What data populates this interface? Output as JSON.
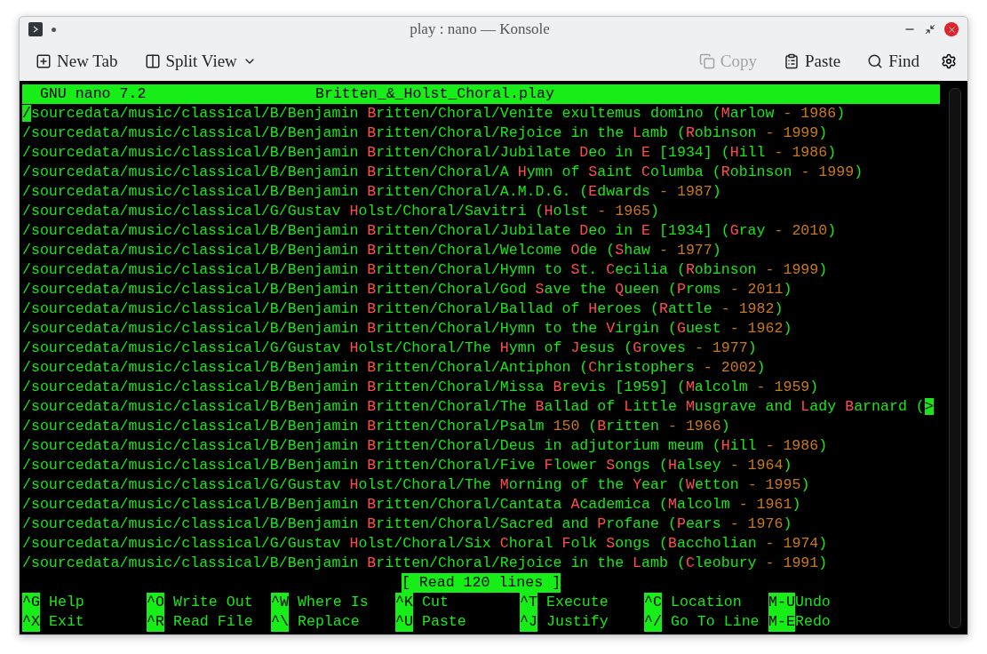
{
  "window": {
    "title": "play : nano — Konsole"
  },
  "toolbar": {
    "left": [
      {
        "label": "New Tab",
        "kind": "new-tab",
        "disabled": false
      },
      {
        "label": "Split View",
        "kind": "split",
        "disabled": false
      }
    ],
    "right": [
      {
        "label": "Copy",
        "kind": "copy",
        "disabled": true
      },
      {
        "label": "Paste",
        "kind": "paste",
        "disabled": false
      },
      {
        "label": "Find",
        "kind": "find",
        "disabled": false
      }
    ]
  },
  "editor": {
    "version": "GNU nano 7.2",
    "filename": "Britten_&_Holst_Choral.play",
    "lines": [
      [
        {
          "text": "/",
          "kind": "cursor"
        },
        {
          "text": "sourcedata/music/classical/B/Benjamin ",
          "kind": "plain"
        },
        {
          "text": "B",
          "kind": "name"
        },
        {
          "text": "ritten/Choral/Venite exultemus domino (",
          "kind": "plain"
        },
        {
          "text": "M",
          "kind": "name"
        },
        {
          "text": "arlow ",
          "kind": "plain"
        },
        {
          "text": "- 1986",
          "kind": "number"
        },
        {
          "text": ")",
          "kind": "plain"
        }
      ],
      [
        {
          "text": "/sourcedata/music/classical/B/Benjamin ",
          "kind": "plain"
        },
        {
          "text": "B",
          "kind": "name"
        },
        {
          "text": "ritten/Choral/Rejoice in the ",
          "kind": "plain"
        },
        {
          "text": "L",
          "kind": "name"
        },
        {
          "text": "amb (",
          "kind": "plain"
        },
        {
          "text": "R",
          "kind": "name"
        },
        {
          "text": "obinson ",
          "kind": "plain"
        },
        {
          "text": "- 1999",
          "kind": "number"
        },
        {
          "text": ")",
          "kind": "plain"
        }
      ],
      [
        {
          "text": "/sourcedata/music/classical/B/Benjamin ",
          "kind": "plain"
        },
        {
          "text": "B",
          "kind": "name"
        },
        {
          "text": "ritten/Choral/Jubilate ",
          "kind": "plain"
        },
        {
          "text": "D",
          "kind": "name"
        },
        {
          "text": "eo in ",
          "kind": "plain"
        },
        {
          "text": "E",
          "kind": "name"
        },
        {
          "text": " [1934] (",
          "kind": "plain"
        },
        {
          "text": "H",
          "kind": "name"
        },
        {
          "text": "ill ",
          "kind": "plain"
        },
        {
          "text": "- 1986",
          "kind": "number"
        },
        {
          "text": ")",
          "kind": "plain"
        }
      ],
      [
        {
          "text": "/sourcedata/music/classical/B/Benjamin ",
          "kind": "plain"
        },
        {
          "text": "B",
          "kind": "name"
        },
        {
          "text": "ritten/Choral/A ",
          "kind": "plain"
        },
        {
          "text": "H",
          "kind": "name"
        },
        {
          "text": "ymn of ",
          "kind": "plain"
        },
        {
          "text": "S",
          "kind": "name"
        },
        {
          "text": "aint ",
          "kind": "plain"
        },
        {
          "text": "C",
          "kind": "name"
        },
        {
          "text": "olumba (",
          "kind": "plain"
        },
        {
          "text": "R",
          "kind": "name"
        },
        {
          "text": "obinson ",
          "kind": "plain"
        },
        {
          "text": "- 1999",
          "kind": "number"
        },
        {
          "text": ")",
          "kind": "plain"
        }
      ],
      [
        {
          "text": "/sourcedata/music/classical/B/Benjamin ",
          "kind": "plain"
        },
        {
          "text": "B",
          "kind": "name"
        },
        {
          "text": "ritten/Choral/A.M.D.G. (",
          "kind": "plain"
        },
        {
          "text": "E",
          "kind": "name"
        },
        {
          "text": "dwards ",
          "kind": "plain"
        },
        {
          "text": "- 1987",
          "kind": "number"
        },
        {
          "text": ")",
          "kind": "plain"
        }
      ],
      [
        {
          "text": "/sourcedata/music/classical/G/Gustav ",
          "kind": "plain"
        },
        {
          "text": "H",
          "kind": "name"
        },
        {
          "text": "olst/Choral/Savitri (",
          "kind": "plain"
        },
        {
          "text": "H",
          "kind": "name"
        },
        {
          "text": "olst ",
          "kind": "plain"
        },
        {
          "text": "- 1965",
          "kind": "number"
        },
        {
          "text": ")",
          "kind": "plain"
        }
      ],
      [
        {
          "text": "/sourcedata/music/classical/B/Benjamin ",
          "kind": "plain"
        },
        {
          "text": "B",
          "kind": "name"
        },
        {
          "text": "ritten/Choral/Jubilate ",
          "kind": "plain"
        },
        {
          "text": "D",
          "kind": "name"
        },
        {
          "text": "eo in ",
          "kind": "plain"
        },
        {
          "text": "E",
          "kind": "name"
        },
        {
          "text": " [1934] (",
          "kind": "plain"
        },
        {
          "text": "G",
          "kind": "name"
        },
        {
          "text": "ray ",
          "kind": "plain"
        },
        {
          "text": "- 2010",
          "kind": "number"
        },
        {
          "text": ")",
          "kind": "plain"
        }
      ],
      [
        {
          "text": "/sourcedata/music/classical/B/Benjamin ",
          "kind": "plain"
        },
        {
          "text": "B",
          "kind": "name"
        },
        {
          "text": "ritten/Choral/Welcome ",
          "kind": "plain"
        },
        {
          "text": "O",
          "kind": "name"
        },
        {
          "text": "de (",
          "kind": "plain"
        },
        {
          "text": "S",
          "kind": "name"
        },
        {
          "text": "haw ",
          "kind": "plain"
        },
        {
          "text": "- 1977",
          "kind": "number"
        },
        {
          "text": ")",
          "kind": "plain"
        }
      ],
      [
        {
          "text": "/sourcedata/music/classical/B/Benjamin ",
          "kind": "plain"
        },
        {
          "text": "B",
          "kind": "name"
        },
        {
          "text": "ritten/Choral/Hymn to ",
          "kind": "plain"
        },
        {
          "text": "S",
          "kind": "name"
        },
        {
          "text": "t. ",
          "kind": "plain"
        },
        {
          "text": "C",
          "kind": "name"
        },
        {
          "text": "ecilia (",
          "kind": "plain"
        },
        {
          "text": "R",
          "kind": "name"
        },
        {
          "text": "obinson ",
          "kind": "plain"
        },
        {
          "text": "- 1999",
          "kind": "number"
        },
        {
          "text": ")",
          "kind": "plain"
        }
      ],
      [
        {
          "text": "/sourcedata/music/classical/B/Benjamin ",
          "kind": "plain"
        },
        {
          "text": "B",
          "kind": "name"
        },
        {
          "text": "ritten/Choral/God ",
          "kind": "plain"
        },
        {
          "text": "S",
          "kind": "name"
        },
        {
          "text": "ave the ",
          "kind": "plain"
        },
        {
          "text": "Q",
          "kind": "name"
        },
        {
          "text": "ueen (",
          "kind": "plain"
        },
        {
          "text": "P",
          "kind": "name"
        },
        {
          "text": "roms ",
          "kind": "plain"
        },
        {
          "text": "- 2011",
          "kind": "number"
        },
        {
          "text": ")",
          "kind": "plain"
        }
      ],
      [
        {
          "text": "/sourcedata/music/classical/B/Benjamin ",
          "kind": "plain"
        },
        {
          "text": "B",
          "kind": "name"
        },
        {
          "text": "ritten/Choral/Ballad of ",
          "kind": "plain"
        },
        {
          "text": "H",
          "kind": "name"
        },
        {
          "text": "eroes (",
          "kind": "plain"
        },
        {
          "text": "R",
          "kind": "name"
        },
        {
          "text": "attle ",
          "kind": "plain"
        },
        {
          "text": "- 1982",
          "kind": "number"
        },
        {
          "text": ")",
          "kind": "plain"
        }
      ],
      [
        {
          "text": "/sourcedata/music/classical/B/Benjamin ",
          "kind": "plain"
        },
        {
          "text": "B",
          "kind": "name"
        },
        {
          "text": "ritten/Choral/Hymn to the ",
          "kind": "plain"
        },
        {
          "text": "V",
          "kind": "name"
        },
        {
          "text": "irgin (",
          "kind": "plain"
        },
        {
          "text": "G",
          "kind": "name"
        },
        {
          "text": "uest ",
          "kind": "plain"
        },
        {
          "text": "- 1962",
          "kind": "number"
        },
        {
          "text": ")",
          "kind": "plain"
        }
      ],
      [
        {
          "text": "/sourcedata/music/classical/G/Gustav ",
          "kind": "plain"
        },
        {
          "text": "H",
          "kind": "name"
        },
        {
          "text": "olst/Choral/The ",
          "kind": "plain"
        },
        {
          "text": "H",
          "kind": "name"
        },
        {
          "text": "ymn of ",
          "kind": "plain"
        },
        {
          "text": "J",
          "kind": "name"
        },
        {
          "text": "esus (",
          "kind": "plain"
        },
        {
          "text": "G",
          "kind": "name"
        },
        {
          "text": "roves ",
          "kind": "plain"
        },
        {
          "text": "- 1977",
          "kind": "number"
        },
        {
          "text": ")",
          "kind": "plain"
        }
      ],
      [
        {
          "text": "/sourcedata/music/classical/B/Benjamin ",
          "kind": "plain"
        },
        {
          "text": "B",
          "kind": "name"
        },
        {
          "text": "ritten/Choral/Antiphon (",
          "kind": "plain"
        },
        {
          "text": "C",
          "kind": "name"
        },
        {
          "text": "hristophers ",
          "kind": "plain"
        },
        {
          "text": "- 2002",
          "kind": "number"
        },
        {
          "text": ")",
          "kind": "plain"
        }
      ],
      [
        {
          "text": "/sourcedata/music/classical/B/Benjamin ",
          "kind": "plain"
        },
        {
          "text": "B",
          "kind": "name"
        },
        {
          "text": "ritten/Choral/Missa ",
          "kind": "plain"
        },
        {
          "text": "B",
          "kind": "name"
        },
        {
          "text": "revis [1959] (",
          "kind": "plain"
        },
        {
          "text": "M",
          "kind": "name"
        },
        {
          "text": "alcolm ",
          "kind": "plain"
        },
        {
          "text": "- 1959",
          "kind": "number"
        },
        {
          "text": ")",
          "kind": "plain"
        }
      ],
      [
        {
          "text": "/sourcedata/music/classical/B/Benjamin ",
          "kind": "plain"
        },
        {
          "text": "B",
          "kind": "name"
        },
        {
          "text": "ritten/Choral/The ",
          "kind": "plain"
        },
        {
          "text": "B",
          "kind": "name"
        },
        {
          "text": "allad of ",
          "kind": "plain"
        },
        {
          "text": "L",
          "kind": "name"
        },
        {
          "text": "ittle ",
          "kind": "plain"
        },
        {
          "text": "M",
          "kind": "name"
        },
        {
          "text": "usgrave and ",
          "kind": "plain"
        },
        {
          "text": "L",
          "kind": "name"
        },
        {
          "text": "ady ",
          "kind": "plain"
        },
        {
          "text": "B",
          "kind": "name"
        },
        {
          "text": "arnard (",
          "kind": "plain"
        },
        {
          "text": ">",
          "kind": "cursor"
        }
      ],
      [
        {
          "text": "/sourcedata/music/classical/B/Benjamin ",
          "kind": "plain"
        },
        {
          "text": "B",
          "kind": "name"
        },
        {
          "text": "ritten/Choral/Psalm ",
          "kind": "plain"
        },
        {
          "text": "150",
          "kind": "number"
        },
        {
          "text": " (",
          "kind": "plain"
        },
        {
          "text": "B",
          "kind": "name"
        },
        {
          "text": "ritten ",
          "kind": "plain"
        },
        {
          "text": "- 1966",
          "kind": "number"
        },
        {
          "text": ")",
          "kind": "plain"
        }
      ],
      [
        {
          "text": "/sourcedata/music/classical/B/Benjamin ",
          "kind": "plain"
        },
        {
          "text": "B",
          "kind": "name"
        },
        {
          "text": "ritten/Choral/Deus in adjutorium meum (",
          "kind": "plain"
        },
        {
          "text": "H",
          "kind": "name"
        },
        {
          "text": "ill ",
          "kind": "plain"
        },
        {
          "text": "- 1986",
          "kind": "number"
        },
        {
          "text": ")",
          "kind": "plain"
        }
      ],
      [
        {
          "text": "/sourcedata/music/classical/B/Benjamin ",
          "kind": "plain"
        },
        {
          "text": "B",
          "kind": "name"
        },
        {
          "text": "ritten/Choral/Five ",
          "kind": "plain"
        },
        {
          "text": "F",
          "kind": "name"
        },
        {
          "text": "lower ",
          "kind": "plain"
        },
        {
          "text": "S",
          "kind": "name"
        },
        {
          "text": "ongs (",
          "kind": "plain"
        },
        {
          "text": "H",
          "kind": "name"
        },
        {
          "text": "alsey ",
          "kind": "plain"
        },
        {
          "text": "- 1964",
          "kind": "number"
        },
        {
          "text": ")",
          "kind": "plain"
        }
      ],
      [
        {
          "text": "/sourcedata/music/classical/G/Gustav ",
          "kind": "plain"
        },
        {
          "text": "H",
          "kind": "name"
        },
        {
          "text": "olst/Choral/The ",
          "kind": "plain"
        },
        {
          "text": "M",
          "kind": "name"
        },
        {
          "text": "orning of the ",
          "kind": "plain"
        },
        {
          "text": "Y",
          "kind": "name"
        },
        {
          "text": "ear (",
          "kind": "plain"
        },
        {
          "text": "W",
          "kind": "name"
        },
        {
          "text": "etton ",
          "kind": "plain"
        },
        {
          "text": "- 1995",
          "kind": "number"
        },
        {
          "text": ")",
          "kind": "plain"
        }
      ],
      [
        {
          "text": "/sourcedata/music/classical/B/Benjamin ",
          "kind": "plain"
        },
        {
          "text": "B",
          "kind": "name"
        },
        {
          "text": "ritten/Choral/Cantata ",
          "kind": "plain"
        },
        {
          "text": "A",
          "kind": "name"
        },
        {
          "text": "cademica (",
          "kind": "plain"
        },
        {
          "text": "M",
          "kind": "name"
        },
        {
          "text": "alcolm ",
          "kind": "plain"
        },
        {
          "text": "- 1961",
          "kind": "number"
        },
        {
          "text": ")",
          "kind": "plain"
        }
      ],
      [
        {
          "text": "/sourcedata/music/classical/B/Benjamin ",
          "kind": "plain"
        },
        {
          "text": "B",
          "kind": "name"
        },
        {
          "text": "ritten/Choral/Sacred and ",
          "kind": "plain"
        },
        {
          "text": "P",
          "kind": "name"
        },
        {
          "text": "rofane (",
          "kind": "plain"
        },
        {
          "text": "P",
          "kind": "name"
        },
        {
          "text": "ears ",
          "kind": "plain"
        },
        {
          "text": "- 1976",
          "kind": "number"
        },
        {
          "text": ")",
          "kind": "plain"
        }
      ],
      [
        {
          "text": "/sourcedata/music/classical/G/Gustav ",
          "kind": "plain"
        },
        {
          "text": "H",
          "kind": "name"
        },
        {
          "text": "olst/Choral/Six ",
          "kind": "plain"
        },
        {
          "text": "C",
          "kind": "name"
        },
        {
          "text": "horal ",
          "kind": "plain"
        },
        {
          "text": "F",
          "kind": "name"
        },
        {
          "text": "olk ",
          "kind": "plain"
        },
        {
          "text": "S",
          "kind": "name"
        },
        {
          "text": "ongs (",
          "kind": "plain"
        },
        {
          "text": "B",
          "kind": "name"
        },
        {
          "text": "accholian ",
          "kind": "plain"
        },
        {
          "text": "- 1974",
          "kind": "number"
        },
        {
          "text": ")",
          "kind": "plain"
        }
      ],
      [
        {
          "text": "/sourcedata/music/classical/B/Benjamin ",
          "kind": "plain"
        },
        {
          "text": "B",
          "kind": "name"
        },
        {
          "text": "ritten/Choral/Rejoice in the ",
          "kind": "plain"
        },
        {
          "text": "L",
          "kind": "name"
        },
        {
          "text": "amb (",
          "kind": "plain"
        },
        {
          "text": "C",
          "kind": "name"
        },
        {
          "text": "leobury ",
          "kind": "plain"
        },
        {
          "text": "- 1991",
          "kind": "number"
        },
        {
          "text": ")",
          "kind": "plain"
        }
      ]
    ],
    "status": "[ Read 120 lines ]",
    "shortcuts": [
      [
        {
          "key": "^G",
          "label": "Help"
        },
        {
          "key": "^O",
          "label": "Write Out"
        },
        {
          "key": "^W",
          "label": "Where Is"
        },
        {
          "key": "^K",
          "label": "Cut"
        },
        {
          "key": "^T",
          "label": "Execute"
        },
        {
          "key": "^C",
          "label": "Location"
        },
        {
          "key": "M-U",
          "label": "Undo"
        }
      ],
      [
        {
          "key": "^X",
          "label": "Exit"
        },
        {
          "key": "^R",
          "label": "Read File"
        },
        {
          "key": "^\\",
          "label": "Replace"
        },
        {
          "key": "^U",
          "label": "Paste"
        },
        {
          "key": "^J",
          "label": "Justify"
        },
        {
          "key": "^/",
          "label": "Go To Line"
        },
        {
          "key": "M-E",
          "label": "Redo"
        }
      ]
    ]
  }
}
